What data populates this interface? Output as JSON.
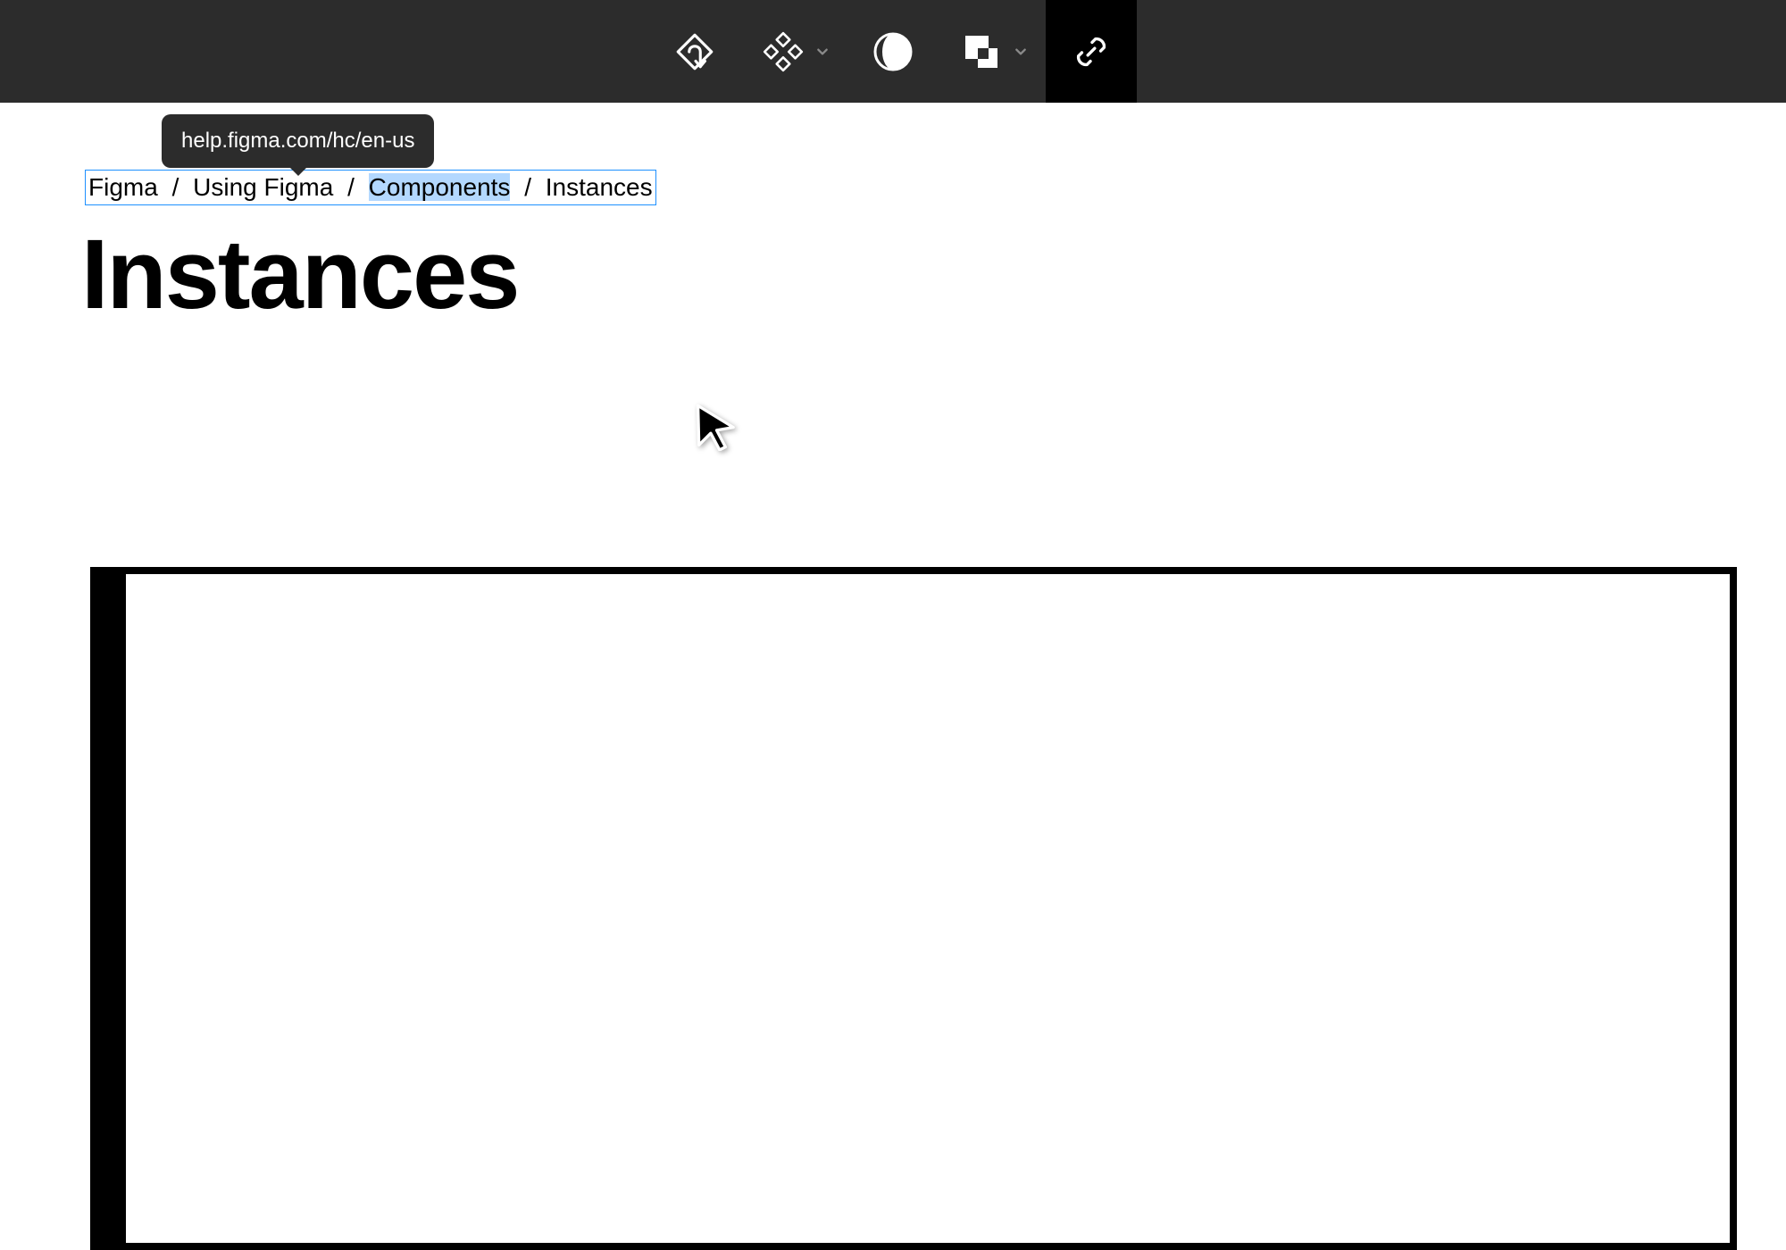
{
  "toolbar": {
    "tools": [
      {
        "id": "branch",
        "icon": "branch-icon",
        "chevron": false,
        "active": false
      },
      {
        "id": "component",
        "icon": "component-icon",
        "chevron": true,
        "active": false
      },
      {
        "id": "mask",
        "icon": "mask-icon",
        "chevron": false,
        "active": false
      },
      {
        "id": "boolean",
        "icon": "boolean-icon",
        "chevron": true,
        "active": false
      },
      {
        "id": "link",
        "icon": "link-icon",
        "chevron": false,
        "active": true
      }
    ]
  },
  "tooltip": {
    "text": "help.figma.com/hc/en-us"
  },
  "breadcrumb": {
    "items": [
      {
        "label": "Figma",
        "highlighted": false
      },
      {
        "label": "Using Figma",
        "highlighted": false
      },
      {
        "label": "Components",
        "highlighted": true
      },
      {
        "label": "Instances",
        "highlighted": false
      }
    ],
    "separator": "/"
  },
  "page": {
    "title": "Instances"
  }
}
